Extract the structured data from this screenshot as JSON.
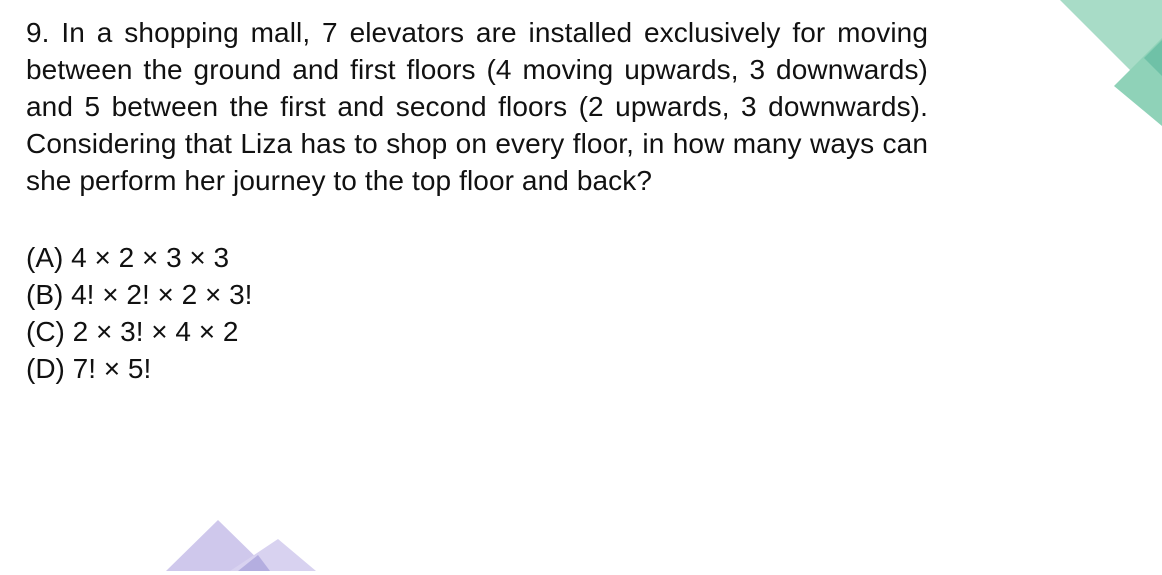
{
  "question": {
    "text": "9. In a shopping mall, 7 elevators are installed exclusively for moving between the ground and first floors (4 moving upwards, 3 downwards) and 5 between the first and second floors (2 upwards, 3 downwards). Considering that Liza has to shop on every floor, in how many ways can she perform her journey to the top floor and back?"
  },
  "options": [
    {
      "text": "(A) 4 × 2 × 3 × 3"
    },
    {
      "text": "(B) 4! × 2! × 2 × 3!"
    },
    {
      "text": "(C) 2 × 3! × 4 × 2"
    },
    {
      "text": "(D) 7! × 5!"
    }
  ],
  "decoration": {
    "teal_shape_color": "#a8dcc7",
    "teal_shape_dark_color": "#6fc1a7",
    "purple_shape_color": "#cfc8ec",
    "purple_shape_dark_color": "#b4aee0"
  }
}
